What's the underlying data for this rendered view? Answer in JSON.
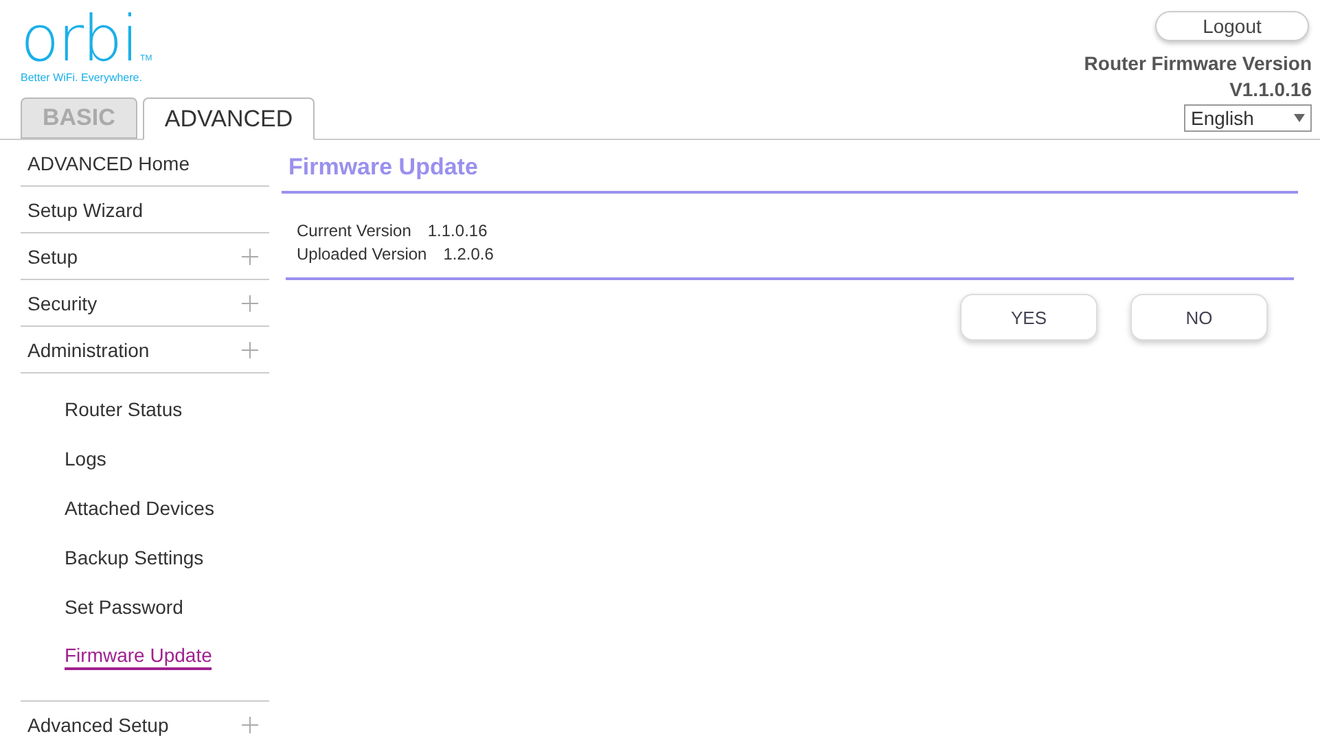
{
  "logo": {
    "name": "orbi",
    "trademark": "TM",
    "tagline": "Better WiFi. Everywhere."
  },
  "tabs": [
    {
      "label": "BASIC",
      "selected": false
    },
    {
      "label": "ADVANCED",
      "selected": true
    }
  ],
  "header": {
    "logout": "Logout",
    "firmware_label": "Router Firmware Version",
    "firmware_version": "V1.1.0.16",
    "language": "English"
  },
  "sidebar": {
    "items": [
      {
        "label": "ADVANCED Home",
        "expandable": false
      },
      {
        "label": "Setup Wizard",
        "expandable": false
      },
      {
        "label": "Setup",
        "expandable": true
      },
      {
        "label": "Security",
        "expandable": true
      },
      {
        "label": "Administration",
        "expandable": true,
        "children": [
          {
            "label": "Router Status",
            "selected": false
          },
          {
            "label": "Logs",
            "selected": false
          },
          {
            "label": "Attached Devices",
            "selected": false
          },
          {
            "label": "Backup Settings",
            "selected": false
          },
          {
            "label": "Set Password",
            "selected": false
          },
          {
            "label": "Firmware Update",
            "selected": true
          }
        ]
      },
      {
        "label": "Advanced Setup",
        "expandable": true
      }
    ]
  },
  "content": {
    "title": "Firmware Update",
    "fields": [
      {
        "label": "Current Version",
        "value": "1.1.0.16"
      },
      {
        "label": "Uploaded Version",
        "value": "1.2.0.6"
      }
    ],
    "buttons": [
      "YES",
      "NO"
    ]
  }
}
